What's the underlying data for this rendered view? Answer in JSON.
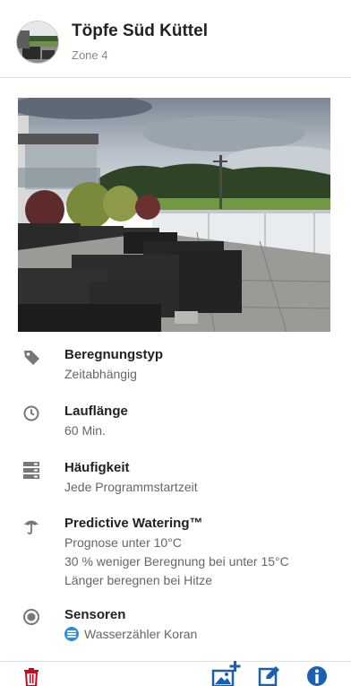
{
  "header": {
    "title": "Töpfe Süd Küttel",
    "subtitle": "Zone 4"
  },
  "details": [
    {
      "label": "Beregnungstyp",
      "values": [
        "Zeitabhängig"
      ],
      "icon": "tag-icon"
    },
    {
      "label": "Lauflänge",
      "values": [
        "60 Min."
      ],
      "icon": "clock-icon"
    },
    {
      "label": "Häufigkeit",
      "values": [
        "Jede Programmstartzeit"
      ],
      "icon": "server-icon"
    },
    {
      "label": "Predictive Watering™",
      "values": [
        "Prognose unter 10°C",
        "30 % weniger Beregnung bei unter 15°C",
        "Länger beregnen bei Hitze"
      ],
      "icon": "umbrella-icon"
    },
    {
      "label": "Sensoren",
      "values": [
        "Wasserzähler Koran"
      ],
      "icon": "sensor-icon"
    }
  ],
  "footer": {
    "delete_icon": "trash-icon",
    "add_image_icon": "add-image-icon",
    "edit_icon": "edit-icon",
    "info_icon": "info-icon"
  },
  "colors": {
    "delete": "#d0021b",
    "accent": "#1a5fb4",
    "sensor": "#2f8de4",
    "icon_gray": "#777777"
  }
}
